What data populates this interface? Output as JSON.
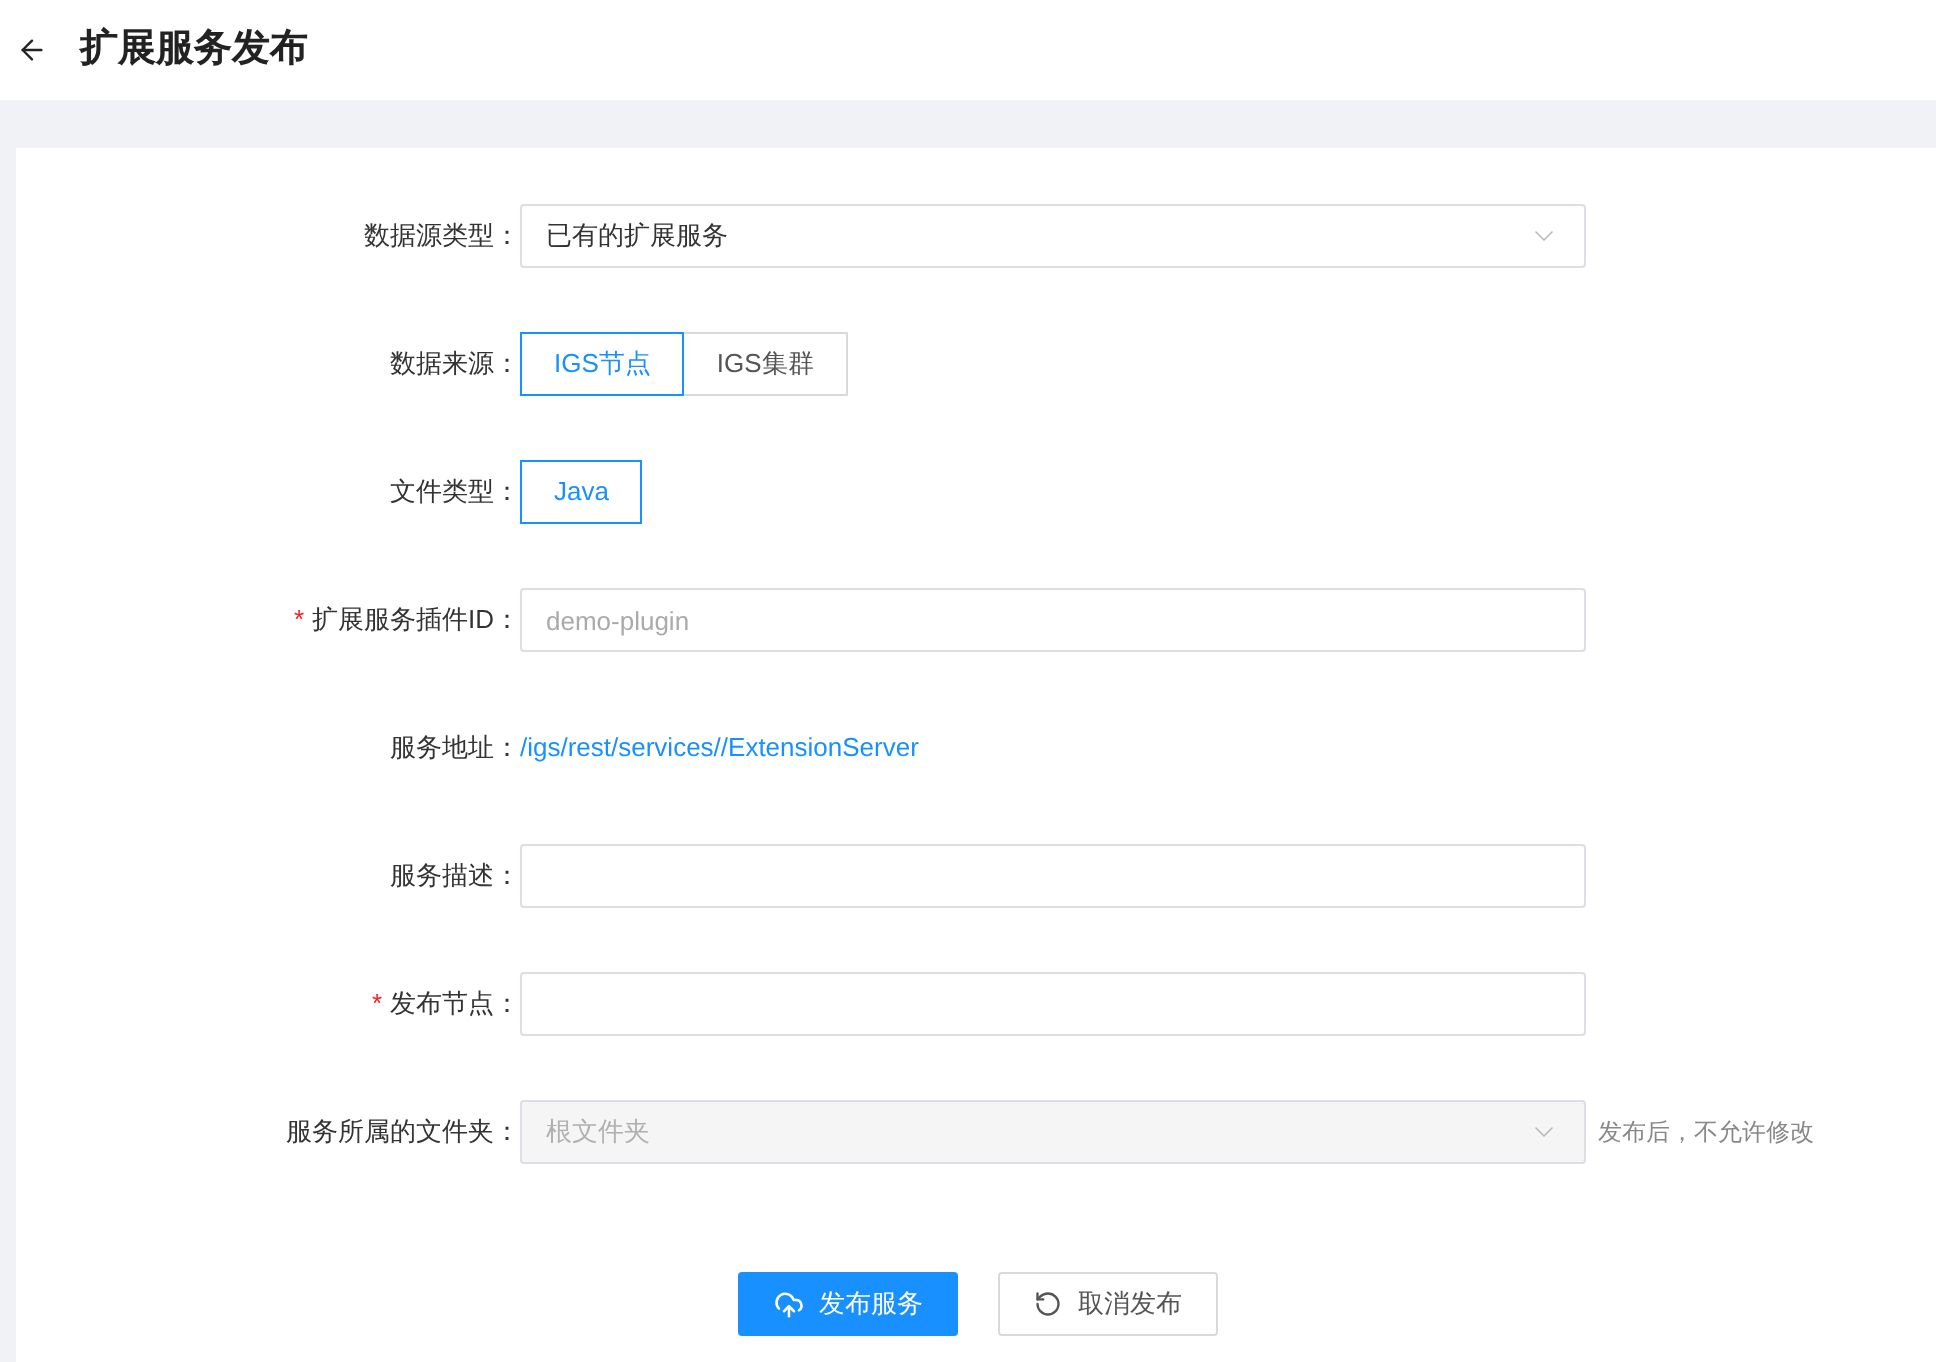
{
  "header": {
    "title": "扩展服务发布"
  },
  "fields": [
    {
      "kind": "select",
      "label": "数据源类型：",
      "disabled": false,
      "value": "已有的扩展服务"
    },
    {
      "kind": "radio",
      "label": "数据来源：",
      "options": [
        {
          "label": "IGS节点",
          "selected": true
        },
        {
          "label": "IGS集群",
          "selected": false
        }
      ]
    },
    {
      "kind": "radio",
      "label": "文件类型：",
      "options": [
        {
          "label": "Java",
          "selected": true
        }
      ]
    },
    {
      "kind": "input",
      "asterisk": "*",
      "label": "扩展服务插件ID：",
      "placeholder": "demo-plugin"
    },
    {
      "kind": "link",
      "label": "服务地址：",
      "value": "/igs/rest/services//ExtensionServer"
    },
    {
      "kind": "input",
      "label": "服务描述："
    },
    {
      "kind": "input",
      "asterisk": "*",
      "label": "发布节点："
    },
    {
      "kind": "select",
      "label": "服务所属的文件夹：",
      "disabled": true,
      "value": "根文件夹",
      "hint": "发布后，不允许修改"
    }
  ],
  "buttons": [
    {
      "kind": "primary",
      "label": "发布服务"
    },
    {
      "kind": "default",
      "label": "取消发布"
    }
  ]
}
